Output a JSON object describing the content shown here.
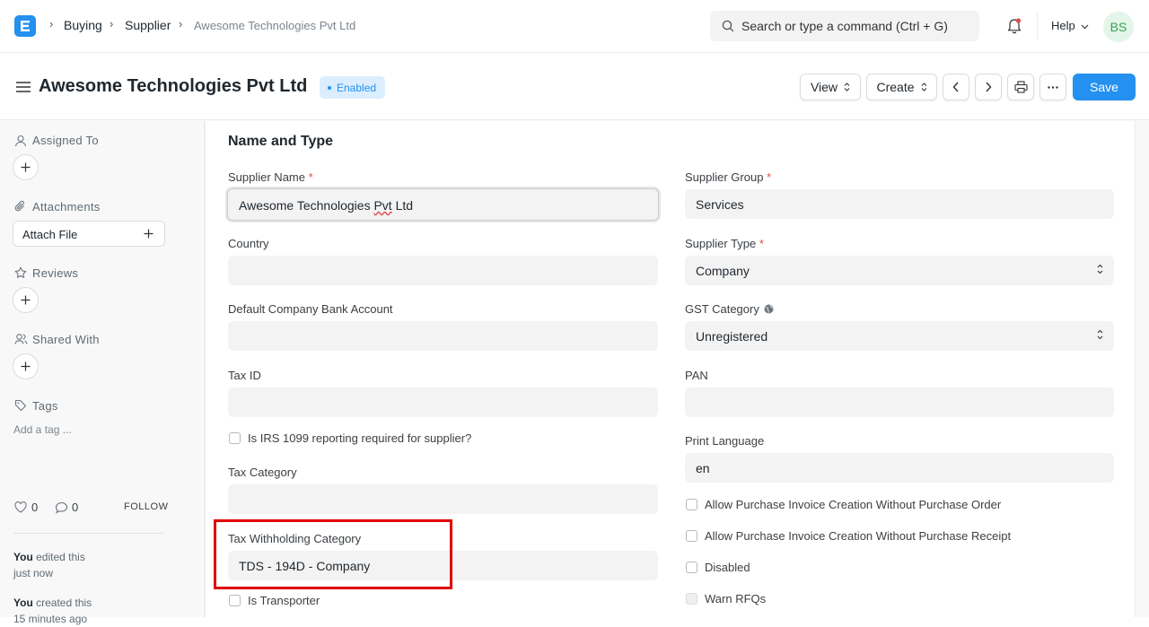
{
  "breadcrumb": {
    "items": [
      "Buying",
      "Supplier",
      "Awesome Technologies Pvt Ltd"
    ]
  },
  "search": {
    "placeholder": "Search or type a command (Ctrl + G)"
  },
  "navbar": {
    "help_label": "Help",
    "avatar_initials": "BS"
  },
  "header": {
    "title": "Awesome Technologies Pvt Ltd",
    "status": "Enabled",
    "view_label": "View",
    "create_label": "Create",
    "save_label": "Save"
  },
  "sidebar": {
    "assigned_to": "Assigned To",
    "attachments": "Attachments",
    "attach_file": "Attach File",
    "reviews": "Reviews",
    "shared_with": "Shared With",
    "tags": "Tags",
    "add_tag": "Add a tag ...",
    "likes": "0",
    "comments": "0",
    "follow": "FOLLOW",
    "activity": [
      {
        "user": "You",
        "action": "edited this",
        "time": "just now"
      },
      {
        "user": "You",
        "action": "created this",
        "time": "15 minutes ago"
      }
    ]
  },
  "form": {
    "section_title": "Name and Type",
    "supplier_name": {
      "label": "Supplier Name",
      "value_prefix": "Awesome Technologies ",
      "value_word": "Pvt",
      "value_suffix": " Ltd"
    },
    "supplier_group": {
      "label": "Supplier Group",
      "value": "Services"
    },
    "country": {
      "label": "Country",
      "value": ""
    },
    "supplier_type": {
      "label": "Supplier Type",
      "value": "Company"
    },
    "bank_account": {
      "label": "Default Company Bank Account",
      "value": ""
    },
    "gst_category": {
      "label": "GST Category",
      "value": "Unregistered"
    },
    "tax_id": {
      "label": "Tax ID",
      "value": ""
    },
    "pan": {
      "label": "PAN",
      "value": ""
    },
    "irs_1099": {
      "label": "Is IRS 1099 reporting required for supplier?"
    },
    "print_language": {
      "label": "Print Language",
      "value": "en"
    },
    "tax_category": {
      "label": "Tax Category",
      "value": ""
    },
    "allow_pi_without_po": {
      "label": "Allow Purchase Invoice Creation Without Purchase Order"
    },
    "allow_pi_without_pr": {
      "label": "Allow Purchase Invoice Creation Without Purchase Receipt"
    },
    "tax_withholding": {
      "label": "Tax Withholding Category",
      "value": "TDS - 194D - Company"
    },
    "disabled": {
      "label": "Disabled"
    },
    "is_transporter": {
      "label": "Is Transporter"
    },
    "warn_rfqs": {
      "label": "Warn RFQs"
    }
  },
  "colors": {
    "primary": "#2490ef",
    "highlight": "#e00000",
    "avatar_bg": "#e4f5e9",
    "avatar_fg": "#38a157"
  }
}
